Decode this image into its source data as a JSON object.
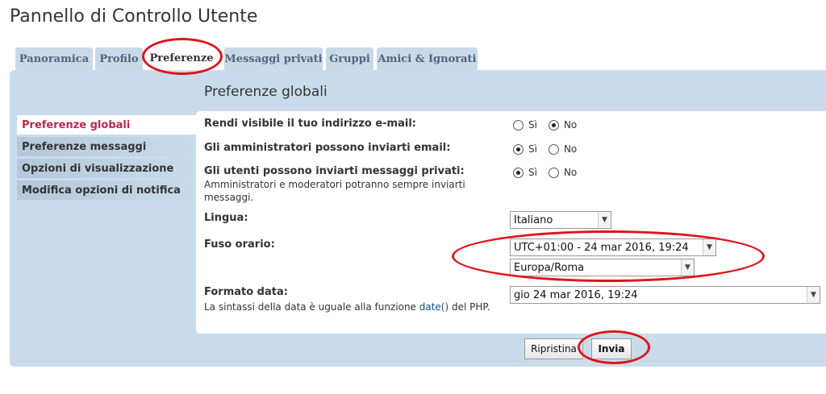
{
  "page": {
    "title": "Pannello di Controllo Utente"
  },
  "tabs": [
    {
      "label": "Panoramica",
      "active": false
    },
    {
      "label": "Profilo",
      "active": false
    },
    {
      "label": "Preferenze",
      "active": true
    },
    {
      "label": "Messaggi privati",
      "active": false
    },
    {
      "label": "Gruppi",
      "active": false
    },
    {
      "label": "Amici & Ignorati",
      "active": false
    }
  ],
  "menu": [
    {
      "label": "Preferenze globali",
      "active": true
    },
    {
      "label": "Preferenze messaggi",
      "active": false
    },
    {
      "label": "Opzioni di visualizzazione",
      "active": false
    },
    {
      "label": "Modifica opzioni di notifica",
      "active": false
    }
  ],
  "section": {
    "title": "Preferenze globali"
  },
  "fields": {
    "email_visible": {
      "label": "Rendi visibile il tuo indirizzo e-mail:",
      "yes": "Sì",
      "no": "No",
      "value": "no"
    },
    "admin_email": {
      "label": "Gli amministratori possono inviarti email:",
      "yes": "Sì",
      "no": "No",
      "value": "yes"
    },
    "pm": {
      "label": "Gli utenti possono inviarti messaggi privati:",
      "explain": "Amministratori e moderatori potranno sempre inviarti messaggi.",
      "yes": "Sì",
      "no": "No",
      "value": "yes"
    },
    "language": {
      "label": "Lingua:",
      "value": "Italiano"
    },
    "timezone": {
      "label": "Fuso orario:",
      "value": "UTC+01:00 - 24 mar 2016, 19:24",
      "zone": "Europa/Roma"
    },
    "date_format": {
      "label": "Formato data:",
      "explain_before": "La sintassi della data è uguale alla funzione ",
      "explain_link": "date()",
      "explain_after": " del PHP.",
      "value": "gio 24 mar 2016, 19:24"
    }
  },
  "buttons": {
    "reset": "Ripristina",
    "submit": "Invia"
  },
  "colors": {
    "panel": "#cadceb",
    "annotation": "#e0141b",
    "active_menu": "#bc2a4d"
  }
}
